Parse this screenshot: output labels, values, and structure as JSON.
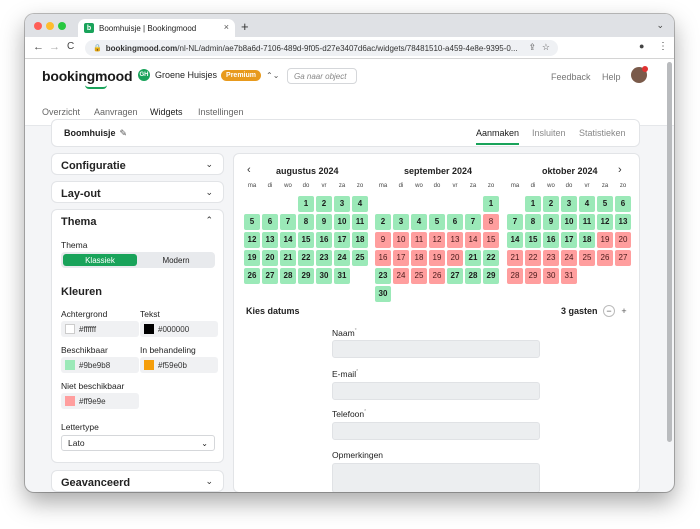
{
  "browser": {
    "tab_title": "Boomhuisje | Bookingmood",
    "favicon_letter": "b",
    "url_domain": "bookingmood.com",
    "url_path": "/nl-NL/admin/ae7b8a6d-7106-489d-9f05-d27e3407d6ac/widgets/78481510-a459-4e8e-9395-0...",
    "back": "←",
    "forward": "→",
    "reload": "C",
    "share": "⇪",
    "star": "☆",
    "profile": "●",
    "menu": "⋮",
    "close": "×",
    "new_tab": "+",
    "tab_strip_chevron": "⌄",
    "traffic_colors": [
      "#ff5f57",
      "#febc2e",
      "#28c840"
    ]
  },
  "app": {
    "logo": "bookingmood",
    "account_initials": "GH",
    "account_name": "Groene Huisjes",
    "plan_badge": "Premium",
    "switch_icon": "⌃⌄",
    "search_placeholder": "Ga naar object",
    "feedback": "Feedback",
    "help": "Help",
    "tabs": [
      "Overzicht",
      "Aanvragen",
      "Widgets",
      "Instellingen"
    ],
    "active_tab": "Widgets"
  },
  "widget": {
    "title": "Boomhuisje",
    "edit_icon": "✎",
    "tabs": [
      "Aanmaken",
      "Insluiten",
      "Statistieken"
    ],
    "active_tab": "Aanmaken"
  },
  "sidebar": {
    "configuratie": "Configuratie",
    "layout": "Lay-out",
    "thema": "Thema",
    "thema_label": "Thema",
    "theme_options": [
      "Klassiek",
      "Modern"
    ],
    "theme_selected": "Klassiek",
    "kleuren": "Kleuren",
    "colors": {
      "achtergrond": {
        "label": "Achtergrond",
        "value": "#ffffff"
      },
      "tekst": {
        "label": "Tekst",
        "value": "#000000"
      },
      "beschikbaar": {
        "label": "Beschikbaar",
        "value": "#9be9b8"
      },
      "in_behandeling": {
        "label": "In behandeling",
        "value": "#f59e0b"
      },
      "niet_beschikbaar": {
        "label": "Niet beschikbaar",
        "value": "#ff9e9e"
      }
    },
    "lettertype_label": "Lettertype",
    "lettertype_value": "Lato",
    "geavanceerd": "Geavanceerd",
    "chevron_down": "⌄",
    "chevron_up": "⌃"
  },
  "calendar": {
    "prev": "‹",
    "next": "›",
    "weekdays": [
      "ma",
      "di",
      "wo",
      "do",
      "vr",
      "za",
      "zo"
    ],
    "months": [
      {
        "title": "augustus 2024",
        "offset": 3,
        "days": 31,
        "unavailable": [],
        "pending": []
      },
      {
        "title": "september 2024",
        "offset": 6,
        "days": 30,
        "unavailable": [
          8,
          9,
          10,
          11,
          12,
          13,
          14,
          15,
          16,
          17,
          18,
          19,
          20,
          24,
          25,
          26
        ],
        "pending": []
      },
      {
        "title": "oktober 2024",
        "offset": 1,
        "days": 31,
        "unavailable": [
          19,
          20,
          21,
          22,
          23,
          24,
          25,
          26,
          27,
          28,
          29,
          30,
          31
        ],
        "pending": []
      }
    ]
  },
  "form": {
    "kies_datums": "Kies datums",
    "guests": "3 gasten",
    "minus": "−",
    "plus": "+",
    "fields": [
      "Naam",
      "E-mail",
      "Telefoon",
      "Opmerkingen"
    ],
    "required_mark": "*"
  }
}
